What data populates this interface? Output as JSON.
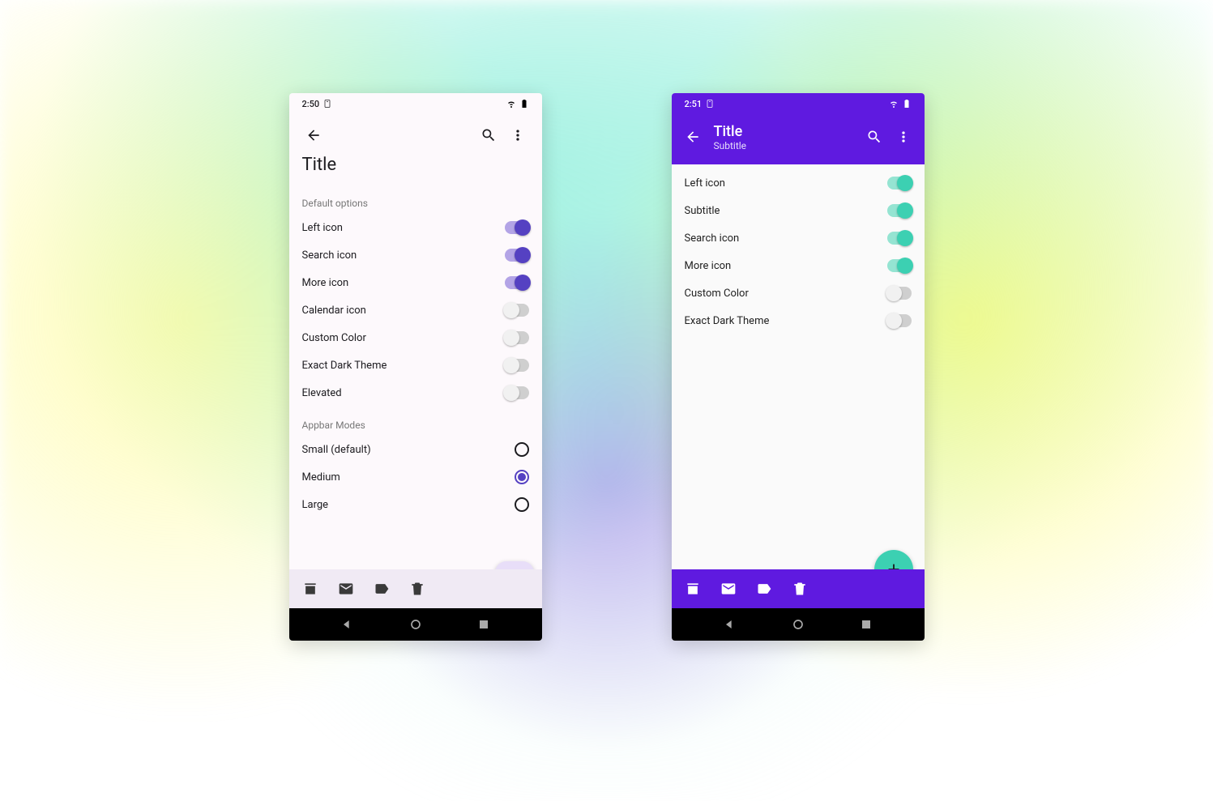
{
  "left": {
    "status_time": "2:50",
    "appbar_title": "Title",
    "section1": "Default options",
    "options1": [
      {
        "label": "Left icon",
        "on": true
      },
      {
        "label": "Search icon",
        "on": true
      },
      {
        "label": "More icon",
        "on": true
      },
      {
        "label": "Calendar icon",
        "on": false
      },
      {
        "label": "Custom Color",
        "on": false
      },
      {
        "label": "Exact Dark Theme",
        "on": false
      },
      {
        "label": "Elevated",
        "on": false
      }
    ],
    "section2": "Appbar Modes",
    "modes": [
      {
        "label": "Small (default)",
        "selected": false
      },
      {
        "label": "Medium",
        "selected": true
      },
      {
        "label": "Large",
        "selected": false
      }
    ]
  },
  "right": {
    "status_time": "2:51",
    "appbar_title": "Title",
    "appbar_subtitle": "Subtitle",
    "options": [
      {
        "label": "Left icon",
        "on": true
      },
      {
        "label": "Subtitle",
        "on": true
      },
      {
        "label": "Search icon",
        "on": true
      },
      {
        "label": "More icon",
        "on": true
      },
      {
        "label": "Custom Color",
        "on": false
      },
      {
        "label": "Exact Dark Theme",
        "on": false
      }
    ]
  }
}
